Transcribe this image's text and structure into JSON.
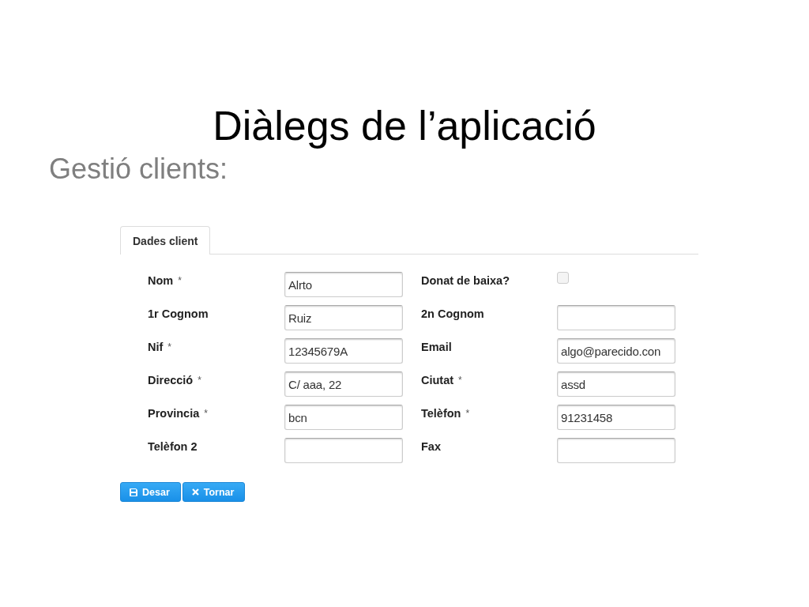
{
  "slide": {
    "title": "Diàlegs de l’aplicació",
    "subtitle": "Gestió clients:"
  },
  "tabs": [
    {
      "label": "Dades client",
      "selected": true
    }
  ],
  "fields": [
    {
      "kind": "text",
      "label": "Nom",
      "required_mark": "*",
      "value": "Alrto"
    },
    {
      "kind": "checkbox",
      "label": "Donat de baixa?",
      "checked": false
    },
    {
      "kind": "text",
      "label": "1r Cognom",
      "value": "Ruiz"
    },
    {
      "kind": "text",
      "label": "2n Cognom"
    },
    {
      "kind": "text",
      "label": "Nif",
      "required_mark": "*",
      "value": "12345679A"
    },
    {
      "kind": "text",
      "label": "Email",
      "value": "algo@parecido.con"
    },
    {
      "kind": "text",
      "label": "Direcció",
      "required_mark": "*",
      "value": "C/ aaa, 22"
    },
    {
      "kind": "text",
      "label": "Ciutat",
      "required_mark": "*",
      "value": "assd"
    },
    {
      "kind": "text",
      "label": "Provincia",
      "required_mark": "*",
      "value": "bcn"
    },
    {
      "kind": "text",
      "label": "Telèfon",
      "required_mark": "*",
      "value": "91231458"
    },
    {
      "kind": "text",
      "label": "Telèfon 2"
    },
    {
      "kind": "text",
      "label": "Fax"
    }
  ],
  "buttons": [
    {
      "kind": "save",
      "label": "Desar"
    },
    {
      "kind": "close",
      "label": "Tornar"
    }
  ]
}
